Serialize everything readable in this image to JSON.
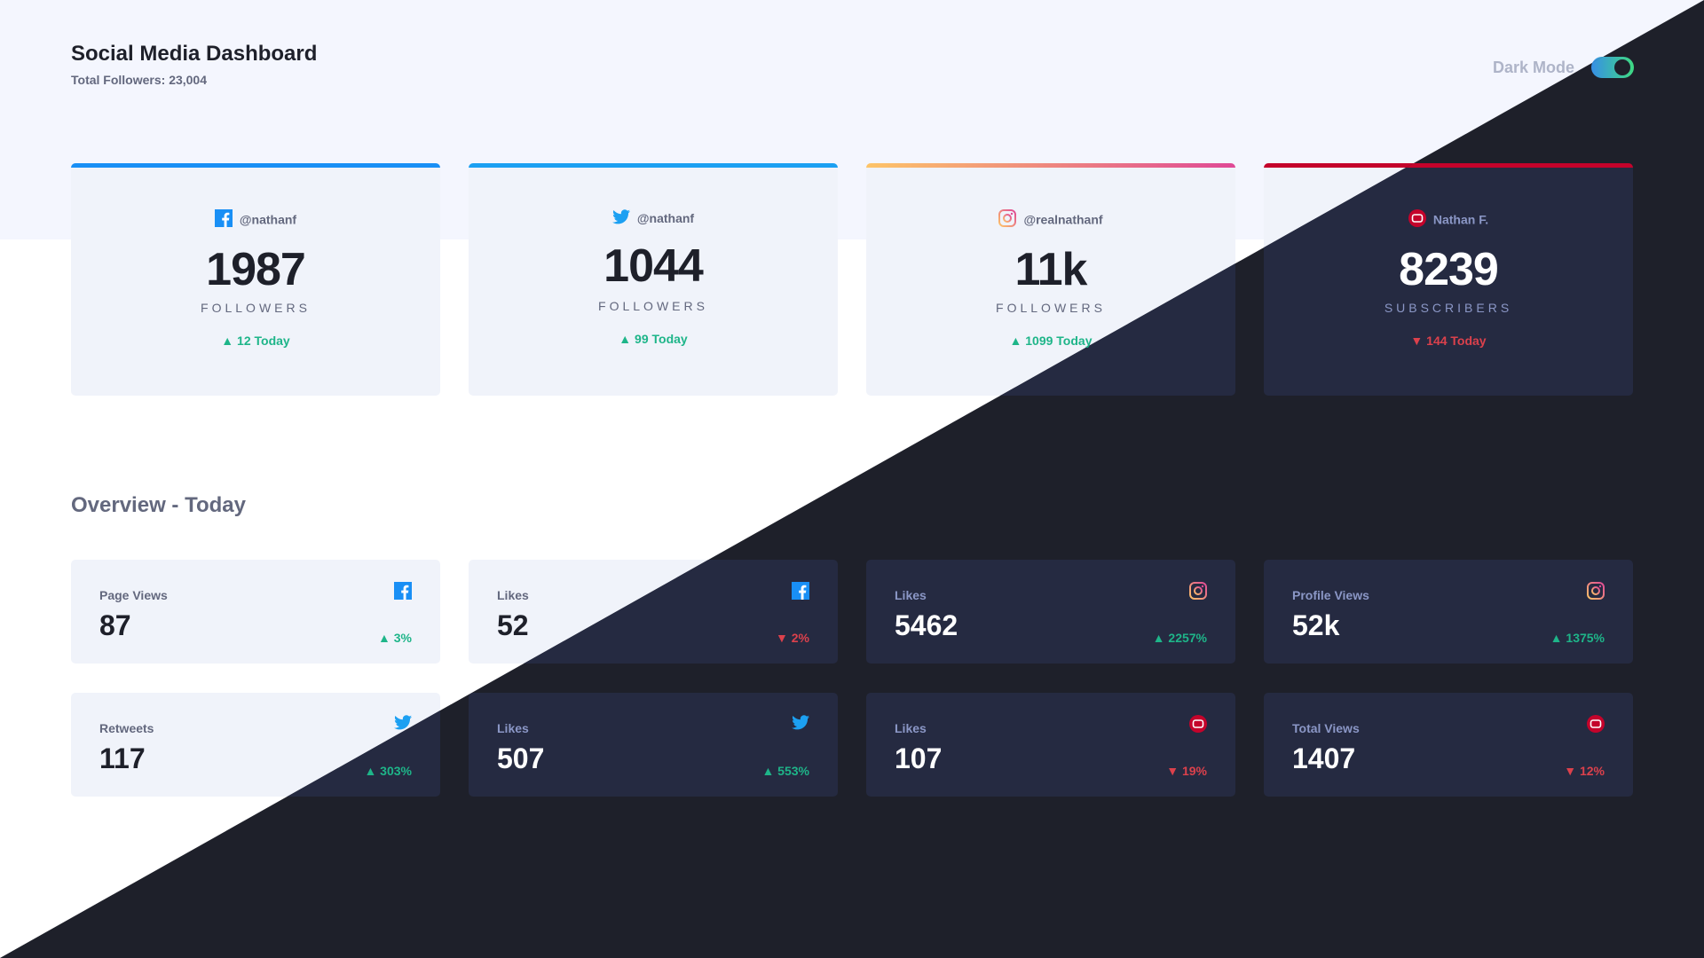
{
  "header": {
    "title": "Social Media Dashboard",
    "total_followers": "Total Followers: 23,004",
    "dark_mode_label": "Dark Mode"
  },
  "colors": {
    "facebook": "#198ff5",
    "twitter": "#1ca0f2",
    "instagram_start": "#fdc468",
    "instagram_end": "#df4996",
    "youtube": "#c4032b",
    "up": "#1eb589",
    "down": "#dc414c",
    "dark_bg": "#1e202a",
    "dark_card": "#252a41",
    "light_card": "#f0f3fa"
  },
  "follower_cards": [
    {
      "platform": "facebook",
      "icon": "facebook-icon",
      "handle": "@nathanf",
      "count": "1987",
      "unit": "FOLLOWERS",
      "today": "▲ 12 Today",
      "trend": "up"
    },
    {
      "platform": "twitter",
      "icon": "twitter-icon",
      "handle": "@nathanf",
      "count": "1044",
      "unit": "FOLLOWERS",
      "today": "▲ 99 Today",
      "trend": "up"
    },
    {
      "platform": "instagram",
      "icon": "instagram-icon",
      "handle": "@realnathanf",
      "count": "11k",
      "unit": "FOLLOWERS",
      "today": "▲ 1099 Today",
      "trend": "up"
    },
    {
      "platform": "youtube",
      "icon": "youtube-icon",
      "handle": "Nathan F.",
      "count": "8239",
      "unit": "SUBSCRIBERS",
      "today": "▼ 144 Today",
      "trend": "down"
    }
  ],
  "overview": {
    "title": "Overview - Today",
    "cards": [
      {
        "label": "Page Views",
        "platform": "facebook",
        "icon": "facebook-icon",
        "value": "87",
        "change": "▲ 3%",
        "trend": "up"
      },
      {
        "label": "Likes",
        "platform": "facebook",
        "icon": "facebook-icon",
        "value": "52",
        "change": "▼ 2%",
        "trend": "down"
      },
      {
        "label": "Likes",
        "platform": "instagram",
        "icon": "instagram-icon",
        "value": "5462",
        "change": "▲ 2257%",
        "trend": "up"
      },
      {
        "label": "Profile Views",
        "platform": "instagram",
        "icon": "instagram-icon",
        "value": "52k",
        "change": "▲ 1375%",
        "trend": "up"
      },
      {
        "label": "Retweets",
        "platform": "twitter",
        "icon": "twitter-icon",
        "value": "117",
        "change": "▲ 303%",
        "trend": "up"
      },
      {
        "label": "Likes",
        "platform": "twitter",
        "icon": "twitter-icon",
        "value": "507",
        "change": "▲ 553%",
        "trend": "up"
      },
      {
        "label": "Likes",
        "platform": "youtube",
        "icon": "youtube-icon",
        "value": "107",
        "change": "▼ 19%",
        "trend": "down"
      },
      {
        "label": "Total Views",
        "platform": "youtube",
        "icon": "youtube-icon",
        "value": "1407",
        "change": "▼ 12%",
        "trend": "down"
      }
    ]
  }
}
